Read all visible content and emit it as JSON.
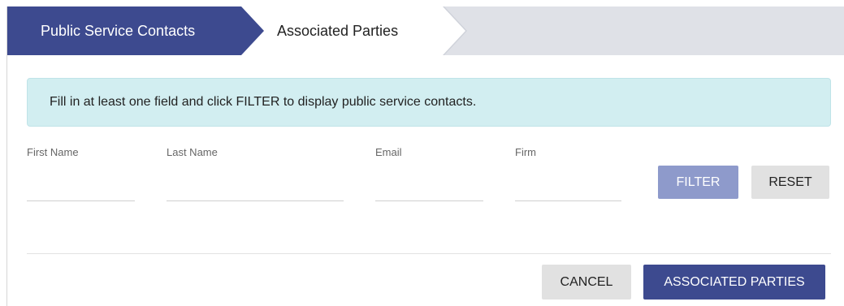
{
  "tabs": {
    "active_label": "Public Service Contacts",
    "next_label": "Associated Parties"
  },
  "alert": {
    "message": "Fill in at least one field and click FILTER to display public service contacts."
  },
  "fields": {
    "first_name": {
      "label": "First Name",
      "value": ""
    },
    "last_name": {
      "label": "Last Name",
      "value": ""
    },
    "email": {
      "label": "Email",
      "value": ""
    },
    "firm": {
      "label": "Firm",
      "value": ""
    }
  },
  "buttons": {
    "filter": "FILTER",
    "reset": "RESET",
    "cancel": "CANCEL",
    "associated_parties": "ASSOCIATED PARTIES"
  },
  "colors": {
    "primary": "#3d4a8f",
    "filter_disabled": "#8e9acb",
    "alert_bg": "#d2eef1",
    "secondary_button": "#e1e1e1",
    "tabbar_bg": "#dfe1e7"
  }
}
